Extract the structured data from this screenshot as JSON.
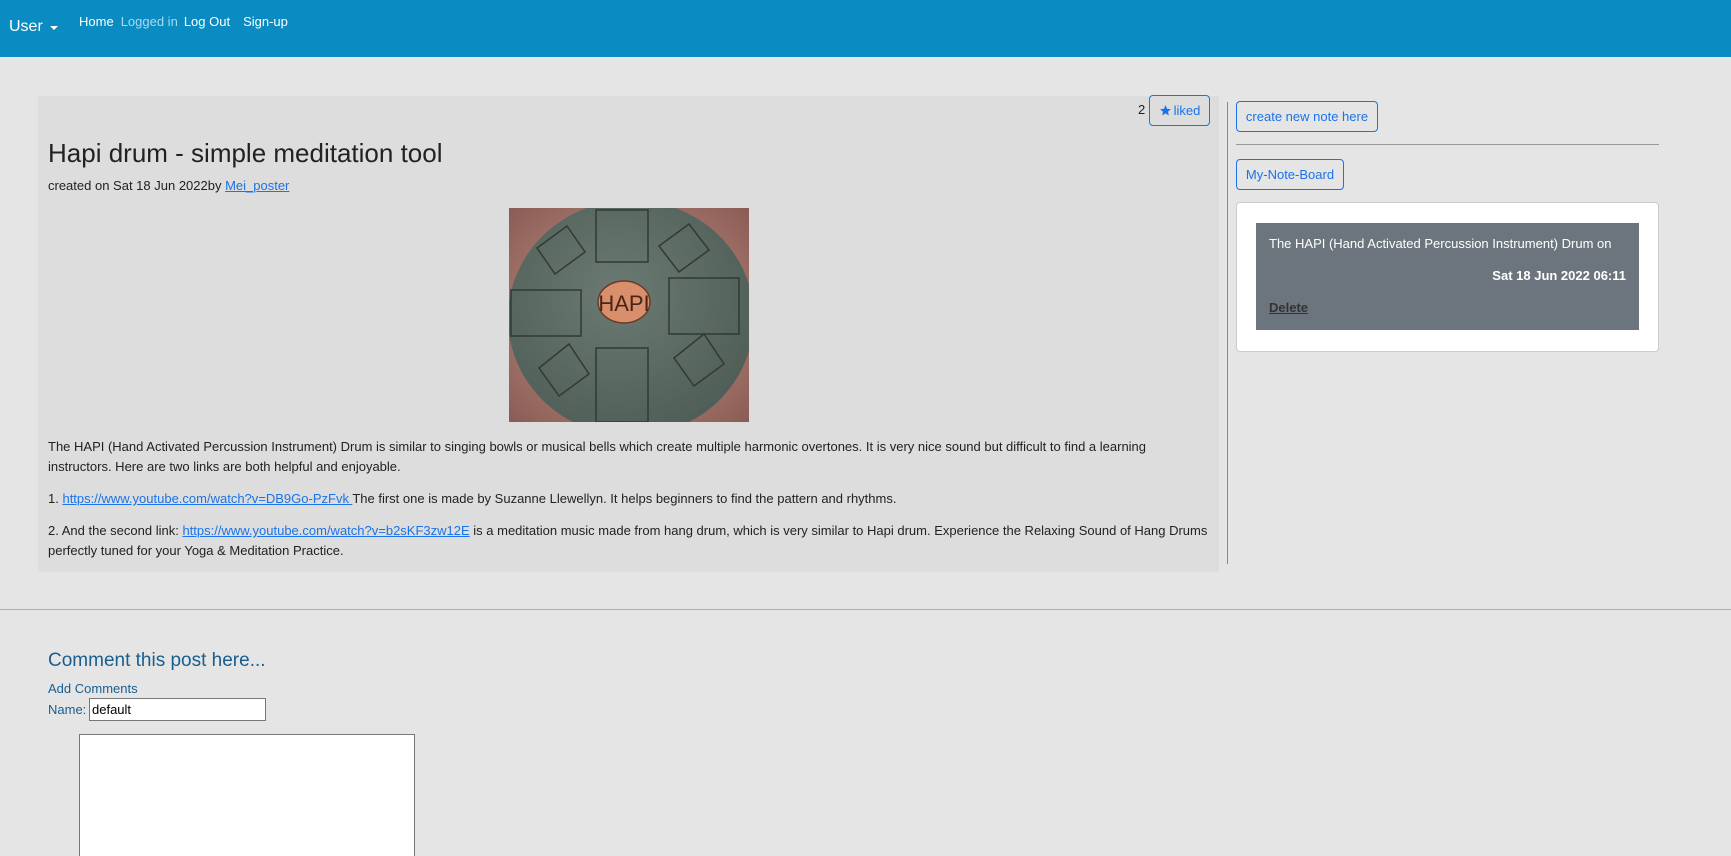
{
  "navbar": {
    "brand": "User",
    "links": {
      "home": "Home",
      "logged_in": "Logged in",
      "logout": "Log Out",
      "signup": "Sign-up"
    },
    "color": "#0a8bc1"
  },
  "post": {
    "like_count": "2",
    "like_label": "liked",
    "title": "Hapi drum - simple meditation tool",
    "meta_prefix": "created on Sat 18 Jun 2022by ",
    "author": "Mei_poster",
    "image_text": "HAPI",
    "paragraph1": "The HAPI (Hand Activated Percussion Instrument) Drum is similar to singing bowls or musical bells which create multiple harmonic overtones. It is very nice sound but difficult to find a learning instructors. Here are two links are both helpful and enjoyable.",
    "item1_prefix": "1. ",
    "item1_link": "https://www.youtube.com/watch?v=DB9Go-PzFvk ",
    "item1_text": "The first one is made by Suzanne Llewellyn. It helps beginners to find the pattern and rhythms.",
    "item2_prefix": "2. And the second link: ",
    "item2_link": "https://www.youtube.com/watch?v=b2sKF3zw12E",
    "item2_text": " is a meditation music made from hang drum, which is very similar to Hapi drum. Experience the Relaxing Sound of Hang Drums perfectly tuned for your Yoga & Meditation Practice."
  },
  "sidebar": {
    "create_note_label": "create new note here",
    "board_label": "My-Note-Board",
    "note": {
      "text": "The HAPI (Hand Activated Percussion Instrument) Drum on",
      "date": "Sat 18 Jun 2022 06:11",
      "delete_label": "Delete"
    }
  },
  "comments": {
    "heading": "Comment this post here...",
    "add_label": "Add Comments",
    "name_label": "Name:",
    "name_value": "default",
    "comment_value": ""
  },
  "icons": {
    "like": "star-icon",
    "brand_dropdown": "caret-down-icon"
  },
  "colors": {
    "accent": "#1a73e8",
    "note_card": "#6c757d",
    "comment_heading": "#1a5e8f"
  }
}
